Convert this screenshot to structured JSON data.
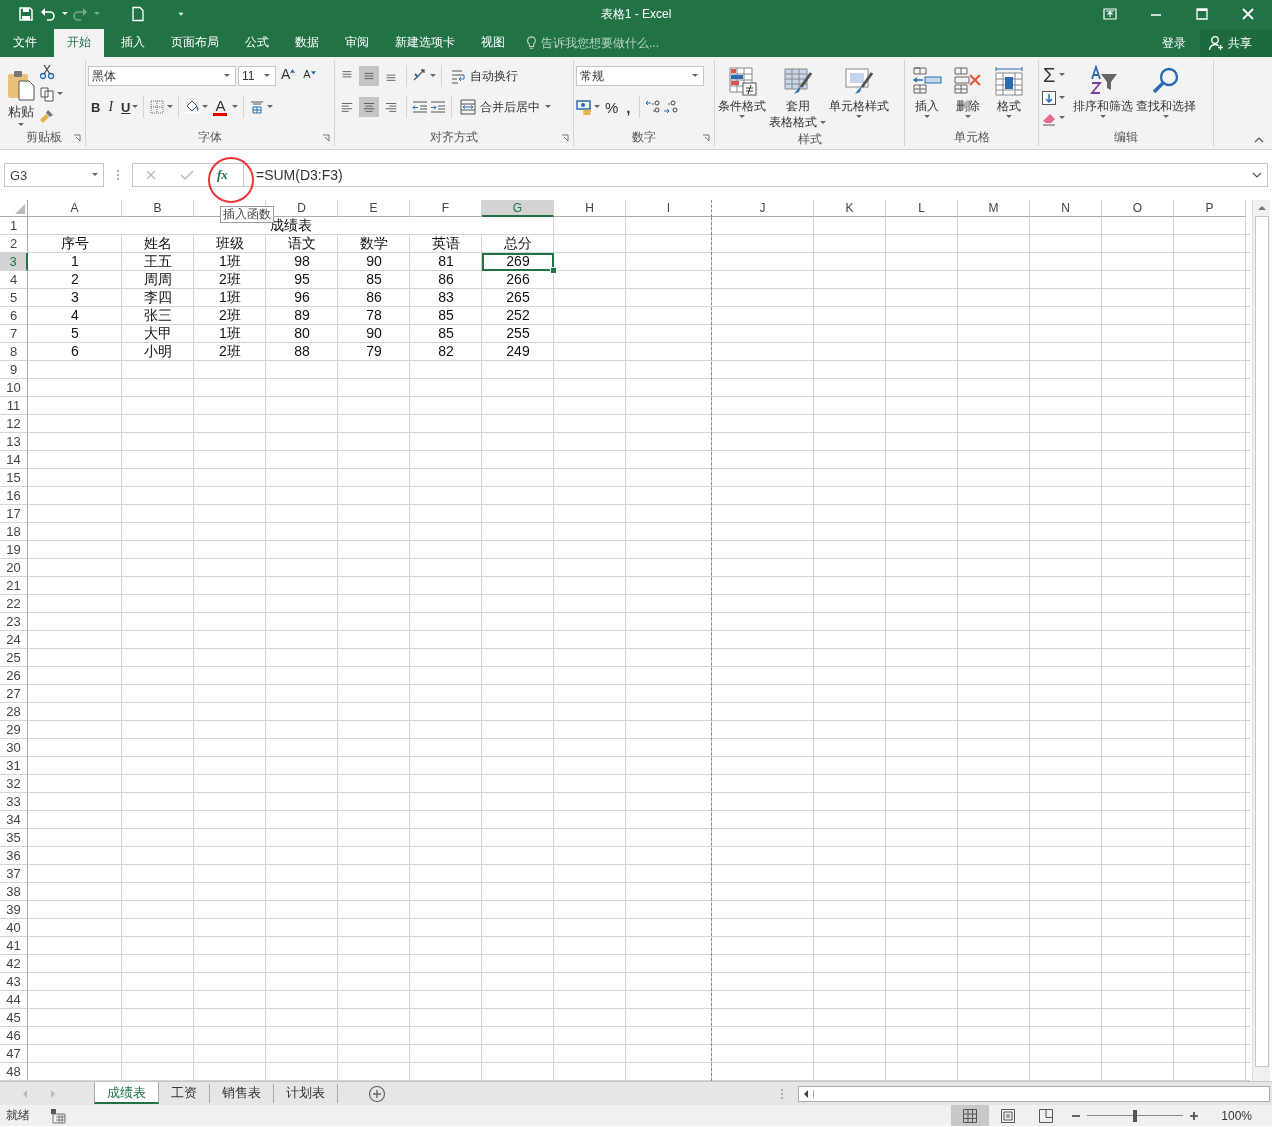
{
  "window": {
    "title": "表格1 - Excel"
  },
  "ribbon_tabs": [
    {
      "label": "文件",
      "selected": false
    },
    {
      "label": "开始",
      "selected": true
    },
    {
      "label": "插入",
      "selected": false
    },
    {
      "label": "页面布局",
      "selected": false
    },
    {
      "label": "公式",
      "selected": false
    },
    {
      "label": "数据",
      "selected": false
    },
    {
      "label": "审阅",
      "selected": false
    },
    {
      "label": "新建选项卡",
      "selected": false
    },
    {
      "label": "视图",
      "selected": false
    }
  ],
  "tell_me": {
    "placeholder": "告诉我您想要做什么..."
  },
  "account": {
    "sign_in": "登录",
    "share": "共享"
  },
  "ribbon": {
    "clipboard": {
      "label": "剪贴板",
      "paste": "粘贴"
    },
    "font": {
      "label": "字体",
      "font_name": "黑体",
      "font_size": "11",
      "grow_font": "A",
      "shrink_font": "A",
      "bold": "B",
      "italic": "I",
      "underline": "U",
      "font_color": "A"
    },
    "alignment": {
      "label": "对齐方式",
      "wrap_text": "自动换行",
      "merge_center": "合并后居中",
      "vertical": [
        {
          "selected": false
        },
        {
          "selected": true
        },
        {
          "selected": false
        }
      ],
      "horizontal": [
        {
          "selected": false
        },
        {
          "selected": true
        },
        {
          "selected": false
        }
      ]
    },
    "number": {
      "label": "数字",
      "format": "常规",
      "percent": "%",
      "comma": ","
    },
    "styles": {
      "label": "样式",
      "buttons": [
        [
          "条件格式"
        ],
        [
          "套用",
          "表格格式"
        ],
        [
          "单元格样式"
        ]
      ]
    },
    "cells": {
      "label": "单元格",
      "buttons": [
        "插入",
        "删除",
        "格式"
      ]
    },
    "editing": {
      "label": "编辑",
      "autosum": "Σ",
      "buttons": [
        "排序和筛选",
        "查找和选择"
      ]
    }
  },
  "formula_bar": {
    "name_box": "G3",
    "function_button": "fx",
    "formula": "=SUM(D3:F3)",
    "tooltip": "插入函数"
  },
  "columns": [
    {
      "label": "A",
      "selected": false,
      "page_break": false
    },
    {
      "label": "B",
      "selected": false,
      "page_break": false
    },
    {
      "selected": false,
      "page_break": false
    },
    {
      "label": "D",
      "selected": false,
      "page_break": false
    },
    {
      "label": "E",
      "selected": false,
      "page_break": false
    },
    {
      "label": "F",
      "selected": false,
      "page_break": false
    },
    {
      "label": "G",
      "selected": true,
      "page_break": false
    },
    {
      "label": "H",
      "selected": false,
      "page_break": false
    },
    {
      "label": "I",
      "selected": false,
      "page_break": true
    },
    {
      "label": "J",
      "selected": false,
      "page_break": false
    },
    {
      "label": "K",
      "selected": false,
      "page_break": false
    },
    {
      "label": "L",
      "selected": false,
      "page_break": false
    },
    {
      "label": "M",
      "selected": false,
      "page_break": false
    },
    {
      "label": "N",
      "selected": false,
      "page_break": false
    },
    {
      "label": "O",
      "selected": false,
      "page_break": false
    },
    {
      "label": "P",
      "selected": false,
      "page_break": false
    }
  ],
  "rows": [
    {
      "number": "1",
      "selected": false,
      "title": "成绩表"
    },
    {
      "number": "2",
      "selected": false,
      "cells": [
        "序号",
        "姓名",
        "班级",
        "语文",
        "数学",
        "英语",
        "总分"
      ]
    },
    {
      "number": "3",
      "selected": true,
      "cells": [
        "1",
        "王五",
        "1班",
        "98",
        "90",
        "81",
        "269"
      ]
    },
    {
      "number": "4",
      "selected": false,
      "cells": [
        "2",
        "周周",
        "2班",
        "95",
        "85",
        "86",
        "266"
      ]
    },
    {
      "number": "5",
      "selected": false,
      "cells": [
        "3",
        "李四",
        "1班",
        "96",
        "86",
        "83",
        "265"
      ]
    },
    {
      "number": "6",
      "selected": false,
      "cells": [
        "4",
        "张三",
        "2班",
        "89",
        "78",
        "85",
        "252"
      ]
    },
    {
      "number": "7",
      "selected": false,
      "cells": [
        "5",
        "大甲",
        "1班",
        "80",
        "90",
        "85",
        "255"
      ]
    },
    {
      "number": "8",
      "selected": false,
      "cells": [
        "6",
        "小明",
        "2班",
        "88",
        "79",
        "82",
        "249"
      ]
    },
    {
      "number": "9",
      "selected": false
    },
    {
      "number": "10",
      "selected": false
    },
    {
      "number": "11",
      "selected": false
    },
    {
      "number": "12",
      "selected": false
    },
    {
      "number": "13",
      "selected": false
    },
    {
      "number": "14",
      "selected": false
    },
    {
      "number": "15",
      "selected": false
    },
    {
      "number": "16",
      "selected": false
    },
    {
      "number": "17",
      "selected": false
    },
    {
      "number": "18",
      "selected": false
    },
    {
      "number": "19",
      "selected": false
    },
    {
      "number": "20",
      "selected": false
    },
    {
      "number": "21",
      "selected": false
    },
    {
      "number": "22",
      "selected": false
    },
    {
      "number": "23",
      "selected": false
    },
    {
      "number": "24",
      "selected": false
    },
    {
      "number": "25",
      "selected": false
    },
    {
      "number": "26",
      "selected": false
    },
    {
      "number": "27",
      "selected": false
    },
    {
      "number": "28",
      "selected": false
    },
    {
      "number": "29",
      "selected": false
    },
    {
      "number": "30",
      "selected": false
    },
    {
      "number": "31",
      "selected": false
    },
    {
      "number": "32",
      "selected": false
    },
    {
      "number": "33",
      "selected": false
    },
    {
      "number": "34",
      "selected": false
    },
    {
      "number": "35",
      "selected": false
    },
    {
      "number": "36",
      "selected": false
    },
    {
      "number": "37",
      "selected": false
    },
    {
      "number": "38",
      "selected": false
    },
    {
      "number": "39",
      "selected": false
    },
    {
      "number": "40",
      "selected": false
    },
    {
      "number": "41",
      "selected": false
    },
    {
      "number": "42",
      "selected": false
    },
    {
      "number": "43",
      "selected": false
    },
    {
      "number": "44",
      "selected": false
    },
    {
      "number": "45",
      "selected": false
    },
    {
      "number": "46",
      "selected": false
    },
    {
      "number": "47",
      "selected": false
    },
    {
      "number": "48",
      "selected": false
    }
  ],
  "sheet_tabs": [
    {
      "label": "成绩表",
      "selected": true
    },
    {
      "label": "工资",
      "selected": false
    },
    {
      "label": "销售表",
      "selected": false
    },
    {
      "label": "计划表",
      "selected": false
    }
  ],
  "status_bar": {
    "status": "就绪",
    "view_buttons": [
      {
        "selected": true
      },
      {
        "selected": false
      },
      {
        "selected": false
      }
    ],
    "zoom_slider": {
      "level": 0.5
    },
    "zoom": "100%"
  }
}
